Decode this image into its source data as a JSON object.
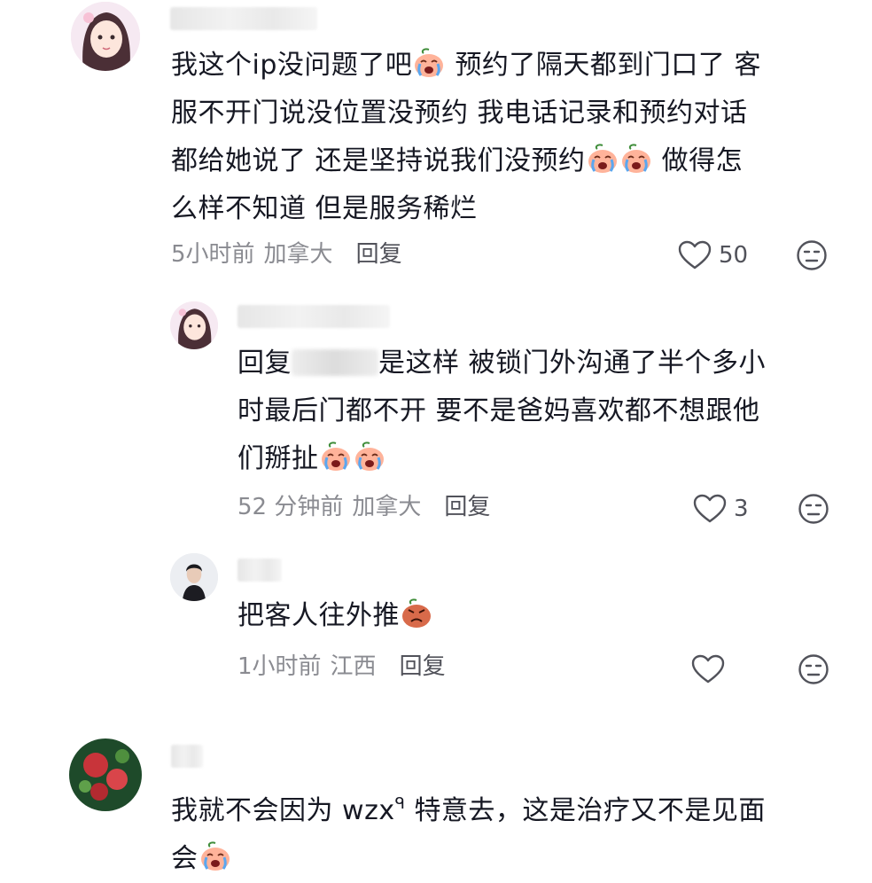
{
  "comments": [
    {
      "avatar": "anime-girl-avatar",
      "text_lines": [
        "我这个ip没问题了吧",
        "预约了隔天都到门口了 客",
        "服不开门说没位置没预约 我电话记录和预约对话",
        "都给她说了 还是坚持说我们没预约",
        "做得怎",
        "么样不知道 但是服务稀烂"
      ],
      "time": "5小时前",
      "location": "加拿大",
      "reply_label": "回复",
      "likes": "50"
    },
    {
      "avatar": "anime-girl-avatar",
      "text_prefix": "回复",
      "text_lines": [
        "是这样 被锁门外沟通了半个多小",
        "时最后门都不开 要不是爸妈喜欢都不想跟他",
        "们掰扯"
      ],
      "time": "52 分钟前",
      "location": "加拿大",
      "reply_label": "回复",
      "likes": "3"
    },
    {
      "avatar": "man-portrait-avatar",
      "text_lines": [
        "把客人往外推"
      ],
      "time": "1小时前",
      "location": "江西",
      "reply_label": "回复",
      "likes": ""
    },
    {
      "avatar": "red-flower-avatar",
      "text_lines": [
        "我就不会因为 wzx",
        "特意去，这是治疗又不是见面",
        "会"
      ],
      "search_icon": "search-superscript-icon"
    }
  ],
  "icons": {
    "like": "heart-outline-icon",
    "dislike": "neutral-face-icon",
    "cry_emoji": "crying-emoji-icon",
    "angry_emoji": "angry-emoji-icon"
  },
  "colors": {
    "text": "#161823",
    "meta": "#8a8b91",
    "reply": "#51525a"
  }
}
